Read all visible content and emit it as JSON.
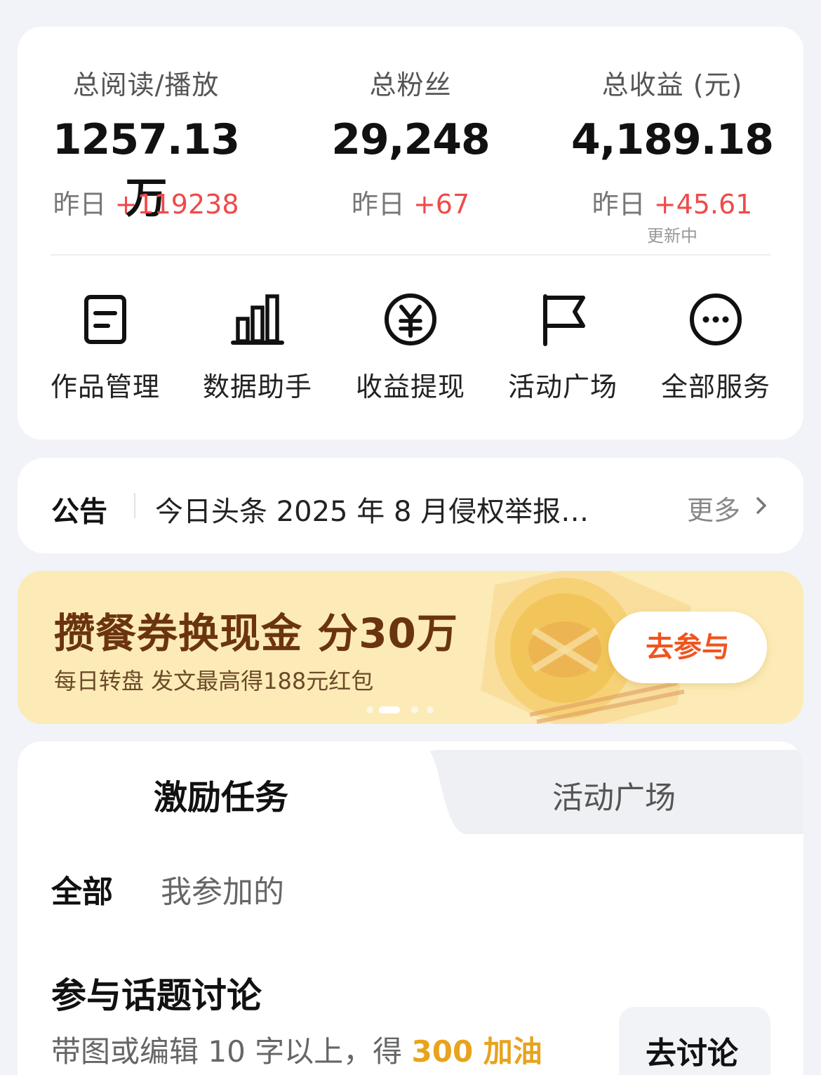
{
  "stats": {
    "reads": {
      "label": "总阅读/播放",
      "value": "1257.13 万",
      "delta_prefix": "昨日",
      "delta": "+119238"
    },
    "fans": {
      "label": "总粉丝",
      "value": "29,248",
      "delta_prefix": "昨日",
      "delta": "+67"
    },
    "income": {
      "label": "总收益 (元)",
      "value": "4,189.18",
      "delta_prefix": "昨日",
      "delta": "+45.61",
      "status": "更新中"
    }
  },
  "services": [
    {
      "label": "作品管理",
      "icon": "document-icon"
    },
    {
      "label": "数据助手",
      "icon": "bar-chart-icon"
    },
    {
      "label": "收益提现",
      "icon": "yuan-coin-icon"
    },
    {
      "label": "活动广场",
      "icon": "flag-icon"
    },
    {
      "label": "全部服务",
      "icon": "more-dots-icon"
    }
  ],
  "notice": {
    "title": "公告",
    "text": "今日头条 2025 年 8 月侵权举报…",
    "more": "更多"
  },
  "banner": {
    "title": "攒餐券换现金 分30万",
    "subtitle": "每日转盘 发文最高得188元红包",
    "button": "去参与",
    "dots_count": 4,
    "active_dot": 1
  },
  "tasks": {
    "tabs": [
      "激励任务",
      "活动广场"
    ],
    "active_tab": 0,
    "filters": [
      "全部",
      "我参加的"
    ],
    "active_filter": 0,
    "item": {
      "title": "参与话题讨论",
      "desc_prefix": "带图或编辑 10 字以上，得 ",
      "reward": "300 加油",
      "button": "去讨论"
    }
  },
  "colors": {
    "page_bg": "#f2f3f8",
    "delta_red": "#ef4a4a",
    "banner_bg": "#fcebb6",
    "banner_title": "#6b3410",
    "banner_button_text": "#f0541e",
    "reward_gold": "#e8a31d"
  }
}
